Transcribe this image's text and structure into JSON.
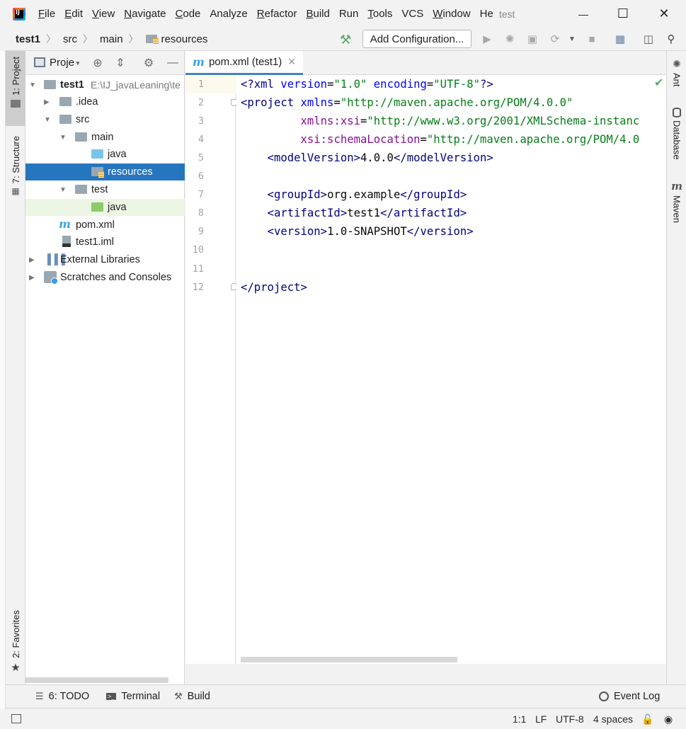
{
  "menubar": {
    "items": [
      {
        "label": "File",
        "u": "F",
        "rest": "ile"
      },
      {
        "label": "Edit",
        "u": "E",
        "rest": "dit"
      },
      {
        "label": "View",
        "u": "V",
        "rest": "iew"
      },
      {
        "label": "Navigate",
        "u": "N",
        "rest": "avigate"
      },
      {
        "label": "Code",
        "u": "C",
        "rest": "ode"
      },
      {
        "label": "Analyze",
        "u": "",
        "rest": "Analyze"
      },
      {
        "label": "Refactor",
        "u": "R",
        "rest": "efactor"
      },
      {
        "label": "Build",
        "u": "B",
        "rest": "uild"
      },
      {
        "label": "Run",
        "u": "",
        "rest": "Run"
      },
      {
        "label": "Tools",
        "u": "T",
        "rest": "ools"
      },
      {
        "label": "VCS",
        "u": "",
        "rest": "VCS"
      },
      {
        "label": "Window",
        "u": "W",
        "rest": "indow"
      },
      {
        "label": "He",
        "u": "",
        "rest": "He"
      }
    ],
    "window_title": "test",
    "minimize": "—",
    "maximize": "☐",
    "close": "✕"
  },
  "navbar": {
    "crumbs": [
      "test1",
      "src",
      "main",
      "resources"
    ],
    "add_configuration": "Add Configuration..."
  },
  "left_strip": {
    "project_tab": "1: Project",
    "structure_tab": "7: Structure",
    "favorites_tab": "2: Favorites"
  },
  "project_panel": {
    "title": "Proje",
    "tree": [
      {
        "label": "test1",
        "hint": "E:\\IJ_javaLeaning\\te"
      },
      {
        "label": ".idea"
      },
      {
        "label": "src"
      },
      {
        "label": "main"
      },
      {
        "label": "java"
      },
      {
        "label": "resources"
      },
      {
        "label": "test"
      },
      {
        "label": "java"
      },
      {
        "label": "pom.xml"
      },
      {
        "label": "test1.iml"
      },
      {
        "label": "External Libraries"
      },
      {
        "label": "Scratches and Consoles"
      }
    ]
  },
  "editor": {
    "tab_label": "pom.xml (test1)",
    "line_numbers": [
      "1",
      "2",
      "3",
      "4",
      "5",
      "6",
      "7",
      "8",
      "9",
      "10",
      "11",
      "12"
    ],
    "code": {
      "l1_open": "<?",
      "l1_xml": "xml",
      "l1_sp1": " ",
      "l1_a1": "version",
      "l1_eq1": "=",
      "l1_v1": "\"1.0\"",
      "l1_sp2": " ",
      "l1_a2": "encoding",
      "l1_eq2": "=",
      "l1_v2": "\"UTF-8\"",
      "l1_close": "?>",
      "l2_tag": "<project",
      "l2_attr": " xmlns",
      "l2_eq": "=",
      "l2_val": "\"http://maven.apache.org/POM/4.0.0\"",
      "l3_indent": "         ",
      "l3_ns": "xmlns:xsi",
      "l3_eq": "=",
      "l3_val": "\"http://www.w3.org/2001/XMLSchema-instanc",
      "l4_indent": "         ",
      "l4_ns": "xsi:schemaLocation",
      "l4_eq": "=",
      "l4_val": "\"http://maven.apache.org/POM/4.0",
      "l5_o": "    <modelVersion>",
      "l5_t": "4.0.0",
      "l5_c": "</modelVersion>",
      "l7_o": "    <groupId>",
      "l7_t": "org.example",
      "l7_c": "</groupId>",
      "l8_o": "    <artifactId>",
      "l8_t": "test1",
      "l8_c": "</artifactId>",
      "l9_o": "    <version>",
      "l9_t": "1.0-SNAPSHOT",
      "l9_c": "</version>",
      "l12": "</project>"
    }
  },
  "right_strip": {
    "ant": "Ant",
    "database": "Database",
    "maven": "Maven"
  },
  "bottom_bar": {
    "todo": "6: TODO",
    "terminal": "Terminal",
    "build": "Build",
    "event_log": "Event Log"
  },
  "status_bar": {
    "position": "1:1",
    "line_sep": "LF",
    "encoding": "UTF-8",
    "indent": "4 spaces"
  },
  "colors": {
    "selection": "#2675bf",
    "tag": "#000080",
    "string": "#067d17",
    "namespace": "#871094",
    "attribute": "#0000ff"
  }
}
